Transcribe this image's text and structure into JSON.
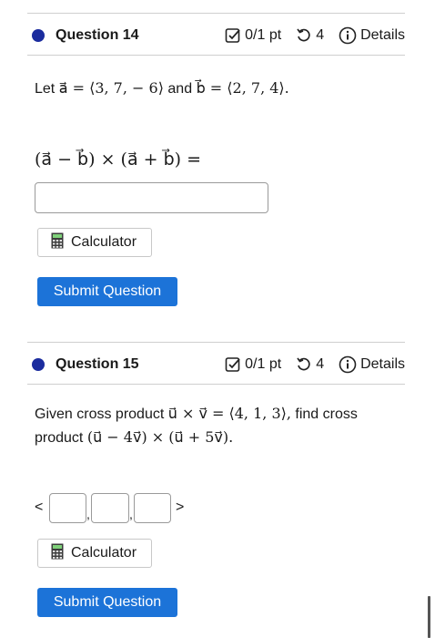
{
  "q14": {
    "title": "Question 14",
    "score": "0/1 pt",
    "attempts": "4",
    "details": "Details",
    "prompt_pre": "Let",
    "prompt_a": "a⃗ = ⟨3, 7, − 6⟩",
    "prompt_and": "and",
    "prompt_b": "b⃗ = ⟨2, 7, 4⟩.",
    "expression": "(a⃗ − b⃗) × (a⃗ + b⃗) =",
    "answer_value": "",
    "calculator_label": "Calculator",
    "submit_label": "Submit Question"
  },
  "q15": {
    "title": "Question 15",
    "score": "0/1 pt",
    "attempts": "4",
    "details": "Details",
    "line1_pre": "Given cross product",
    "line1_math": "u⃗ × v⃗ = ⟨4, 1, 3⟩,",
    "line1_post": "find cross",
    "line2_pre": "product",
    "line2_math": "(u⃗ − 4v⃗) × (u⃗ + 5v⃗).",
    "open_bracket": "<",
    "comma": ",",
    "close_bracket": ">",
    "calculator_label": "Calculator",
    "submit_label": "Submit Question"
  },
  "icons": {
    "score": "checkbox-icon",
    "attempts": "retry-icon",
    "details": "info-icon",
    "calculator": "calculator-icon"
  },
  "colors": {
    "accent": "#1c73d8",
    "dot": "#1b2c9e"
  }
}
